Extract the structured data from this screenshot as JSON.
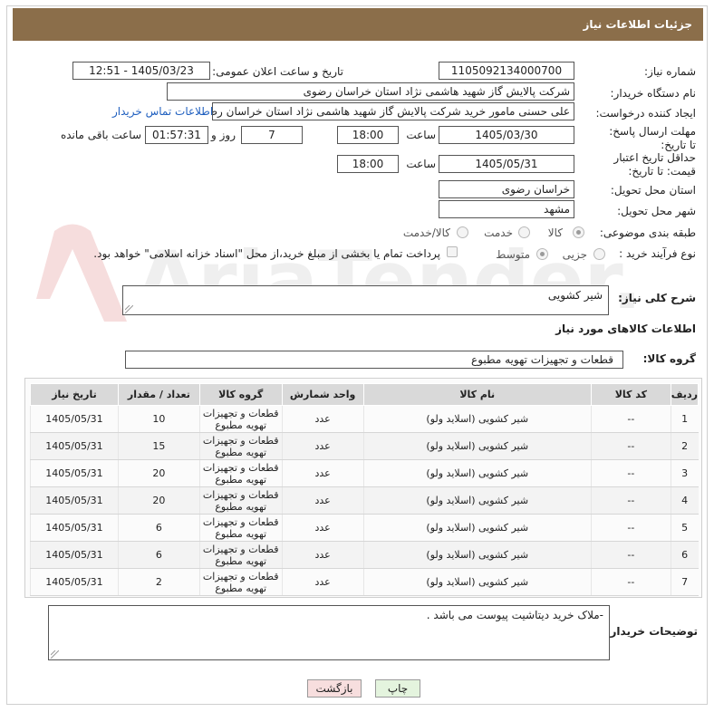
{
  "header": {
    "title": "جزئیات اطلاعات نیاز"
  },
  "form": {
    "need_number_label": "شماره نیاز:",
    "need_number_value": "1105092134000700",
    "announce_label": "تاریخ و ساعت اعلان عمومی:",
    "announce_value": "1405/03/23 - 12:51",
    "buyer_org_label": "نام دستگاه خریدار:",
    "buyer_org_value": "شرکت پالایش گاز شهید هاشمی نژاد   استان خراسان رضوی",
    "requester_label": "ایجاد کننده درخواست:",
    "requester_value": "علی حسنی مامور خرید شرکت پالایش گاز شهید هاشمی نژاد   استان خراسان رضوی",
    "contact_link": "اطلاعات تماس خریدار",
    "reply_deadline_label": "مهلت ارسال پاسخ: تا تاریخ:",
    "reply_date": "1405/03/30",
    "time_label": "ساعت",
    "reply_time": "18:00",
    "days_value": "7",
    "days_label": "روز و",
    "remaining_value": "01:57:31",
    "remaining_label": "ساعت باقی مانده",
    "price_deadline_label": "حداقل تاریخ اعتبار قیمت: تا تاریخ:",
    "price_date": "1405/05/31",
    "price_time": "18:00",
    "delivery_province_label": "استان محل تحویل:",
    "delivery_province_value": "خراسان رضوی",
    "delivery_city_label": "شهر محل تحویل:",
    "delivery_city_value": "مشهد",
    "category_label": "طبقه بندی موضوعی:",
    "category_options": [
      "کالا",
      "خدمت",
      "کالا/خدمت"
    ],
    "category_selected": "کالا",
    "process_label": "نوع فرآیند خرید :",
    "process_options": [
      "جزیی",
      "متوسط"
    ],
    "process_selected": "متوسط",
    "payment_note": "پرداخت تمام یا بخشی از مبلغ خرید،از محل \"اسناد خزانه اسلامی\" خواهد بود."
  },
  "summary": {
    "label": "شرح کلی نیاز:",
    "value": "شیر کشویی"
  },
  "goods": {
    "section_title": "اطلاعات کالاهای مورد نیاز",
    "group_label": "گروه کالا:",
    "group_value": "قطعات و تجهیزات تهویه مطبوع",
    "columns": [
      "ردیف",
      "کد کالا",
      "نام کالا",
      "واحد شمارش",
      "گروه کالا",
      "تعداد / مقدار",
      "تاریخ نیاز"
    ],
    "rows": [
      {
        "idx": "1",
        "code": "--",
        "name": "شیر کشویی (اسلاید ولو)",
        "unit": "عدد",
        "group": "قطعات و تجهیزات تهویه مطبوع",
        "qty": "10",
        "date": "1405/05/31"
      },
      {
        "idx": "2",
        "code": "--",
        "name": "شیر کشویی (اسلاید ولو)",
        "unit": "عدد",
        "group": "قطعات و تجهیزات تهویه مطبوع",
        "qty": "15",
        "date": "1405/05/31"
      },
      {
        "idx": "3",
        "code": "--",
        "name": "شیر کشویی (اسلاید ولو)",
        "unit": "عدد",
        "group": "قطعات و تجهیزات تهویه مطبوع",
        "qty": "20",
        "date": "1405/05/31"
      },
      {
        "idx": "4",
        "code": "--",
        "name": "شیر کشویی (اسلاید ولو)",
        "unit": "عدد",
        "group": "قطعات و تجهیزات تهویه مطبوع",
        "qty": "20",
        "date": "1405/05/31"
      },
      {
        "idx": "5",
        "code": "--",
        "name": "شیر کشویی (اسلاید ولو)",
        "unit": "عدد",
        "group": "قطعات و تجهیزات تهویه مطبوع",
        "qty": "6",
        "date": "1405/05/31"
      },
      {
        "idx": "6",
        "code": "--",
        "name": "شیر کشویی (اسلاید ولو)",
        "unit": "عدد",
        "group": "قطعات و تجهیزات تهویه مطبوع",
        "qty": "6",
        "date": "1405/05/31"
      },
      {
        "idx": "7",
        "code": "--",
        "name": "شیر کشویی (اسلاید ولو)",
        "unit": "عدد",
        "group": "قطعات و تجهیزات تهویه مطبوع",
        "qty": "2",
        "date": "1405/05/31"
      }
    ]
  },
  "notes": {
    "label": "توضیحات خریدار:",
    "value": "-ملاک خرید دیتاشیت پیوست می باشد ."
  },
  "buttons": {
    "print": "چاپ",
    "back": "بازگشت"
  },
  "colors": {
    "header_bg": "#8b6e4a",
    "link": "#1f5fbf",
    "back_button_bg": "#f7dede",
    "print_button_bg": "#e4f4de"
  },
  "watermark_text": "AriaTender.neT"
}
